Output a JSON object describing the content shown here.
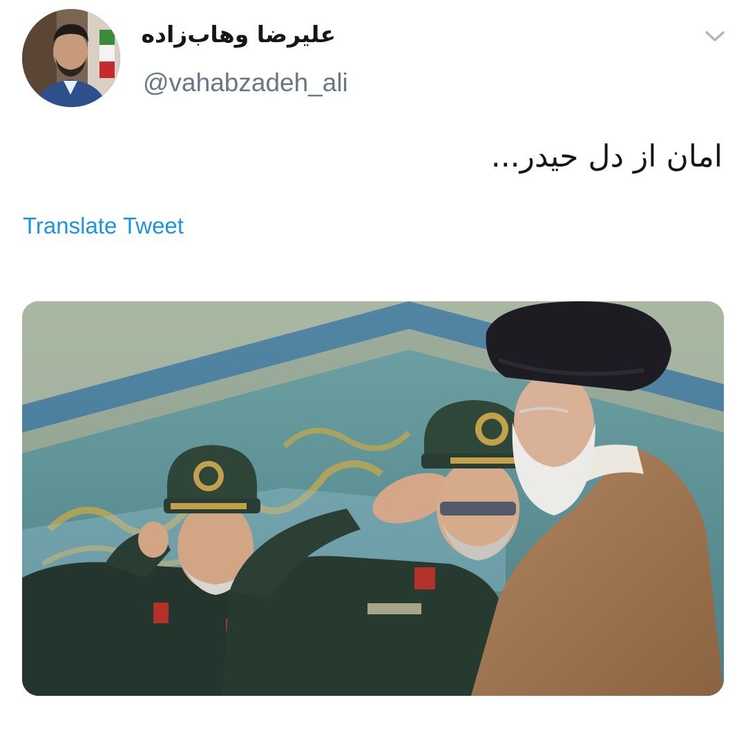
{
  "tweet": {
    "author": {
      "display_name": "علیرضا وهاب‌زاده",
      "handle": "@vahabzadeh_ali",
      "avatar_icon": "profile-photo"
    },
    "menu_icon": "chevron-down-icon",
    "text": "امان از دل حیدر...",
    "translate_label": "Translate Tweet",
    "media": {
      "kind": "photo",
      "description_icon": "attached-photo"
    }
  },
  "colors": {
    "text": "#14171a",
    "secondary": "#657786",
    "link": "#1b95e0",
    "chevron": "#aab8c2",
    "background": "#ffffff"
  }
}
